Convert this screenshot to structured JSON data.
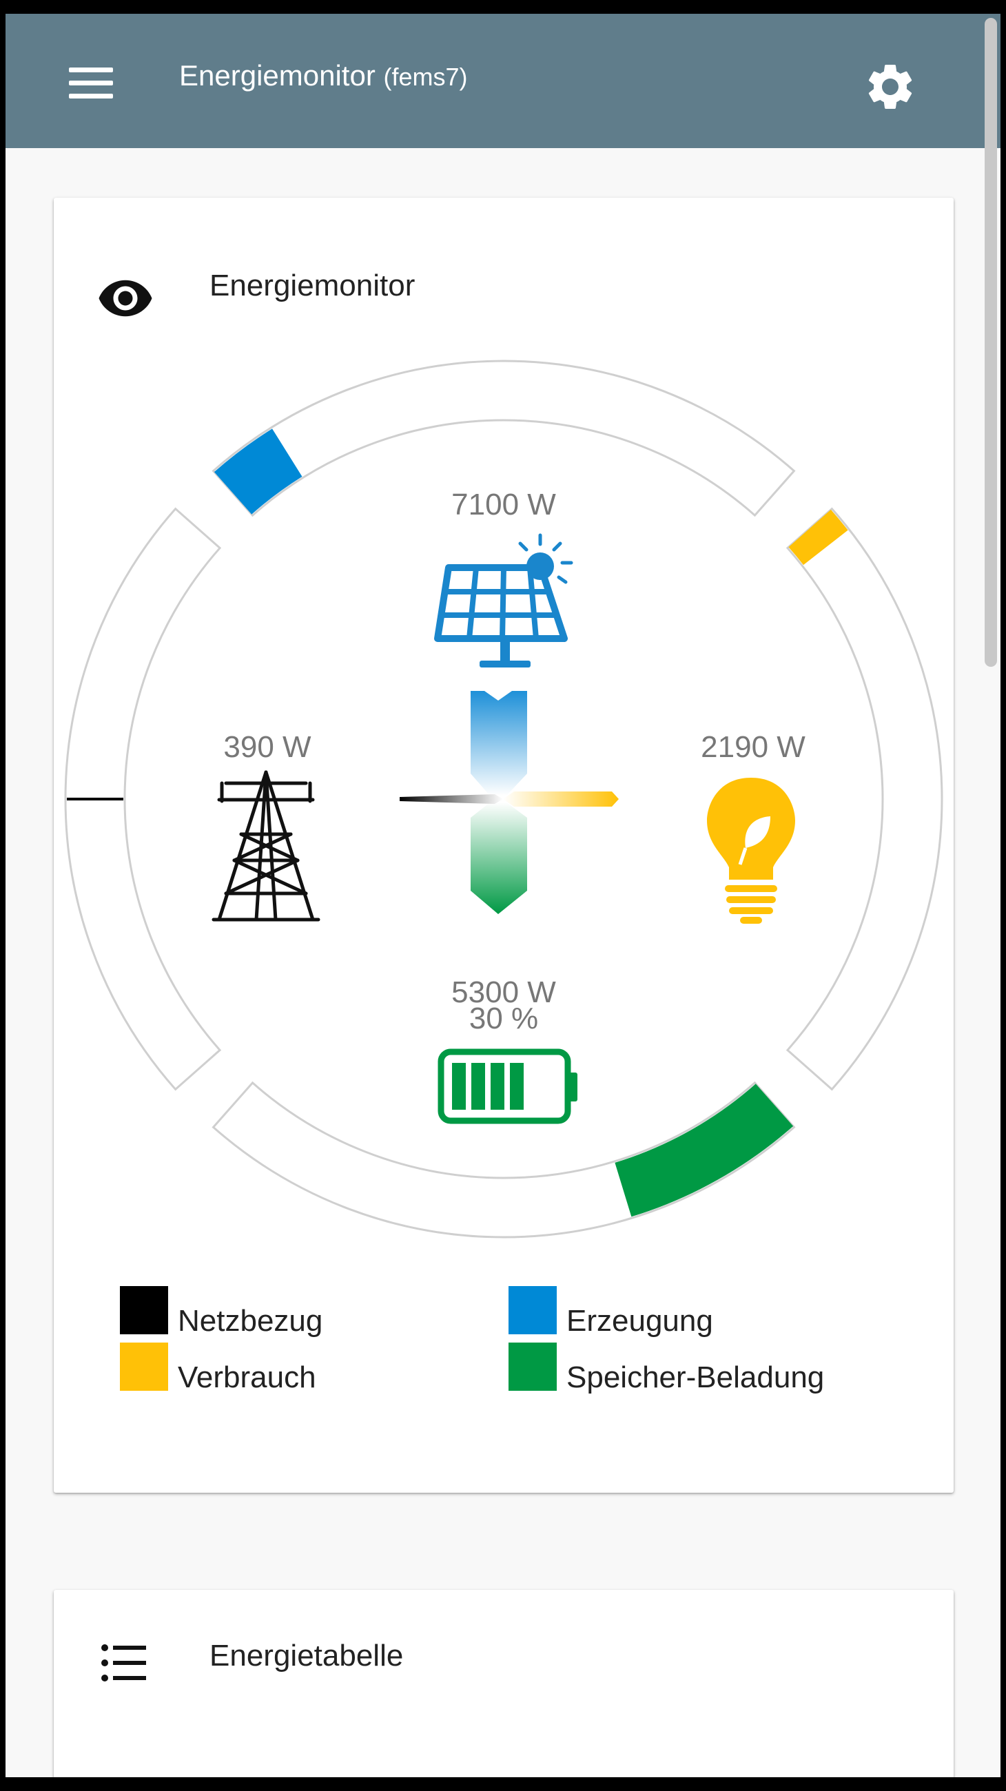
{
  "toolbar": {
    "title": "Energiemonitor",
    "subtitle": "(fems7)",
    "menu_icon": "menu-icon",
    "settings_icon": "settings-gear-icon"
  },
  "energy_card": {
    "title": "Energiemonitor",
    "icon": "eye-icon",
    "production": {
      "value": "7100 W",
      "icon": "solar-panel-icon",
      "color": "#0089d6"
    },
    "grid": {
      "value": "390 W",
      "icon": "power-pylon-icon",
      "color": "#000000"
    },
    "consumption": {
      "value": "2190 W",
      "icon": "lightbulb-leaf-icon",
      "color": "#ffc107"
    },
    "storage": {
      "value": "5300 W",
      "soc": "30 %",
      "soc_fraction": 0.3,
      "icon": "battery-icon",
      "color": "#009944"
    },
    "legend": [
      {
        "label": "Netzbezug",
        "color": "#000000"
      },
      {
        "label": "Erzeugung",
        "color": "#0089d6"
      },
      {
        "label": "Verbrauch",
        "color": "#ffc107"
      },
      {
        "label": "Speicher-Beladung",
        "color": "#009944"
      }
    ]
  },
  "table_card": {
    "title": "Energietabelle",
    "icon": "list-icon"
  }
}
